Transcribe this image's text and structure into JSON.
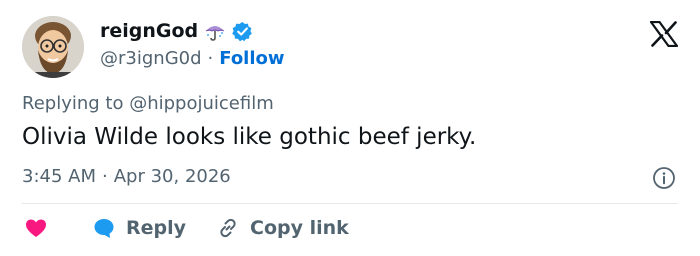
{
  "user": {
    "display_name": "reignGod",
    "handle": "@r3ignG0d",
    "separator": "·",
    "follow_label": "Follow",
    "emoji": "umbrella-emoji"
  },
  "reply_context": {
    "prefix": "Replying to",
    "mention": "@hippojuicefilm"
  },
  "tweet": {
    "text": "Olivia Wilde looks like gothic beef jerky.",
    "time": "3:45 AM",
    "separator": "·",
    "date": "Apr 30, 2026"
  },
  "actions": {
    "like_icon": "heart-icon",
    "reply_label": "Reply",
    "copy_link_label": "Copy link"
  },
  "colors": {
    "text": "#0f1419",
    "secondary": "#536471",
    "follow": "#006fd6",
    "verified": "#1d9bf0",
    "heart": "#f91880",
    "reply_bubble": "#1d9bf0",
    "divider": "#e5e9ec"
  },
  "icons": [
    "x-logo-icon",
    "verified-badge-icon",
    "info-icon",
    "heart-icon",
    "reply-bubble-icon",
    "link-icon",
    "avatar"
  ]
}
